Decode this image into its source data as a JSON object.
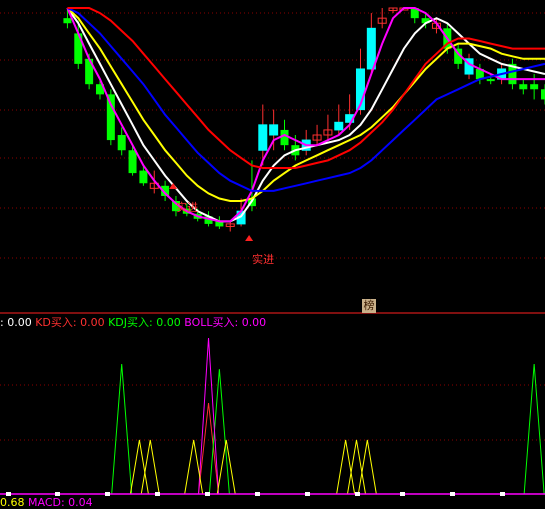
{
  "colors": {
    "bg": "#000000",
    "grid": "#8b0000",
    "up": "#00ffff",
    "down": "#00ff00",
    "ma_white": "#ffffff",
    "ma_yellow": "#ffff00",
    "ma_magenta": "#ff00ff",
    "ma_blue": "#0000ff",
    "ma_red": "#ff0000",
    "signal_text": "#ff3030"
  },
  "price_panel": {
    "signal_labels": [
      "实进",
      "实进",
      "实进"
    ],
    "badge": "榜"
  },
  "indicator_legend": {
    "items": [
      {
        "label": ": 0.00",
        "color": "#ffffff"
      },
      {
        "label": "KD买入: 0.00",
        "color": "#ff3030"
      },
      {
        "label": "KDJ买入: 0.00",
        "color": "#00ff00"
      },
      {
        "label": "BOLL买入: 0.00",
        "color": "#ff00ff"
      }
    ]
  },
  "macd_legend": {
    "items": [
      {
        "label": "0.68",
        "color": "#ffff00"
      },
      {
        "label": "MACD: 0.04",
        "color": "#ff00ff"
      }
    ]
  },
  "chart_data": [
    {
      "type": "candlestick",
      "title": "",
      "ylim": [
        0,
        100
      ],
      "candles": [
        {
          "o": 96,
          "c": 94,
          "h": 100,
          "l": 92,
          "up": false
        },
        {
          "o": 90,
          "c": 78,
          "h": 95,
          "l": 76,
          "up": false
        },
        {
          "o": 80,
          "c": 70,
          "h": 82,
          "l": 68,
          "up": false
        },
        {
          "o": 70,
          "c": 66,
          "h": 72,
          "l": 64,
          "up": false
        },
        {
          "o": 66,
          "c": 48,
          "h": 68,
          "l": 46,
          "up": false
        },
        {
          "o": 50,
          "c": 44,
          "h": 53,
          "l": 42,
          "up": false
        },
        {
          "o": 44,
          "c": 35,
          "h": 46,
          "l": 34,
          "up": false
        },
        {
          "o": 36,
          "c": 31,
          "h": 38,
          "l": 30,
          "up": false
        },
        {
          "o": 31,
          "c": 29,
          "h": 36,
          "l": 27,
          "up": true
        },
        {
          "o": 30,
          "c": 26,
          "h": 32,
          "l": 24,
          "up": false
        },
        {
          "o": 24,
          "c": 20,
          "h": 26,
          "l": 18,
          "up": false
        },
        {
          "o": 21,
          "c": 19,
          "h": 23,
          "l": 18,
          "up": false
        },
        {
          "o": 19,
          "c": 17,
          "h": 21,
          "l": 16,
          "up": false
        },
        {
          "o": 18,
          "c": 15,
          "h": 20,
          "l": 14,
          "up": false
        },
        {
          "o": 16,
          "c": 14,
          "h": 18,
          "l": 13,
          "up": false
        },
        {
          "o": 15,
          "c": 14,
          "h": 16,
          "l": 12,
          "up": true
        },
        {
          "o": 15,
          "c": 20,
          "h": 25,
          "l": 14,
          "up": true
        },
        {
          "o": 25,
          "c": 22,
          "h": 40,
          "l": 20,
          "up": false
        },
        {
          "o": 44,
          "c": 54,
          "h": 62,
          "l": 38,
          "up": true
        },
        {
          "o": 50,
          "c": 54,
          "h": 60,
          "l": 44,
          "up": true
        },
        {
          "o": 52,
          "c": 46,
          "h": 56,
          "l": 44,
          "up": false
        },
        {
          "o": 46,
          "c": 42,
          "h": 50,
          "l": 40,
          "up": false
        },
        {
          "o": 44,
          "c": 48,
          "h": 52,
          "l": 42,
          "up": true
        },
        {
          "o": 48,
          "c": 50,
          "h": 54,
          "l": 46,
          "up": true
        },
        {
          "o": 50,
          "c": 52,
          "h": 58,
          "l": 48,
          "up": true
        },
        {
          "o": 52,
          "c": 55,
          "h": 62,
          "l": 50,
          "up": true
        },
        {
          "o": 55,
          "c": 58,
          "h": 66,
          "l": 52,
          "up": true
        },
        {
          "o": 60,
          "c": 76,
          "h": 84,
          "l": 58,
          "up": true
        },
        {
          "o": 76,
          "c": 92,
          "h": 98,
          "l": 74,
          "up": true
        },
        {
          "o": 94,
          "c": 96,
          "h": 100,
          "l": 92,
          "up": true
        },
        {
          "o": 99,
          "c": 100,
          "h": 100,
          "l": 98,
          "up": true
        },
        {
          "o": 100,
          "c": 100,
          "h": 100,
          "l": 100,
          "up": true
        },
        {
          "o": 100,
          "c": 96,
          "h": 100,
          "l": 94,
          "up": false
        },
        {
          "o": 96,
          "c": 94,
          "h": 98,
          "l": 92,
          "up": false
        },
        {
          "o": 94,
          "c": 92,
          "h": 96,
          "l": 90,
          "up": true
        },
        {
          "o": 92,
          "c": 84,
          "h": 94,
          "l": 82,
          "up": false
        },
        {
          "o": 84,
          "c": 78,
          "h": 86,
          "l": 76,
          "up": false
        },
        {
          "o": 80,
          "c": 74,
          "h": 82,
          "l": 72,
          "up": true
        },
        {
          "o": 76,
          "c": 72,
          "h": 78,
          "l": 70,
          "up": false
        },
        {
          "o": 72,
          "c": 72,
          "h": 74,
          "l": 70,
          "up": false
        },
        {
          "o": 72,
          "c": 76,
          "h": 78,
          "l": 70,
          "up": true
        },
        {
          "o": 78,
          "c": 70,
          "h": 80,
          "l": 68,
          "up": false
        },
        {
          "o": 70,
          "c": 68,
          "h": 72,
          "l": 66,
          "up": false
        },
        {
          "o": 70,
          "c": 68,
          "h": 74,
          "l": 64,
          "up": false
        },
        {
          "o": 68,
          "c": 64,
          "h": 70,
          "l": 62,
          "up": false
        }
      ],
      "series": [
        {
          "color": "#ffffff",
          "values": [
            100,
            94,
            86,
            78,
            70,
            62,
            54,
            46,
            40,
            34,
            29,
            24,
            20,
            18,
            16,
            16,
            18,
            24,
            32,
            38,
            42,
            44,
            45,
            46,
            47,
            48,
            50,
            54,
            60,
            68,
            76,
            84,
            90,
            94,
            96,
            94,
            90,
            86,
            82,
            80,
            78,
            77,
            76,
            75,
            74
          ]
        },
        {
          "color": "#ffff00",
          "values": [
            100,
            96,
            90,
            84,
            77,
            70,
            63,
            56,
            50,
            44,
            39,
            34,
            30,
            27,
            25,
            24,
            24,
            25,
            28,
            32,
            35,
            38,
            40,
            42,
            44,
            46,
            48,
            50,
            53,
            57,
            61,
            66,
            71,
            76,
            80,
            84,
            86,
            86,
            85,
            84,
            82,
            81,
            80,
            80,
            80
          ]
        },
        {
          "color": "#ff00ff",
          "values": [
            100,
            90,
            80,
            72,
            62,
            54,
            46,
            38,
            32,
            27,
            23,
            20,
            18,
            17,
            16,
            16,
            20,
            28,
            40,
            48,
            50,
            48,
            46,
            46,
            48,
            50,
            54,
            62,
            74,
            86,
            96,
            100,
            100,
            98,
            94,
            88,
            82,
            78,
            76,
            74,
            72,
            72,
            72,
            72,
            72
          ]
        },
        {
          "color": "#0000ff",
          "values": [
            100,
            98,
            94,
            90,
            85,
            80,
            75,
            70,
            64,
            58,
            53,
            48,
            43,
            39,
            35,
            32,
            30,
            28,
            28,
            28,
            29,
            30,
            31,
            32,
            33,
            34,
            35,
            37,
            40,
            44,
            48,
            52,
            56,
            60,
            64,
            66,
            68,
            70,
            72,
            73,
            74,
            75,
            76,
            77,
            78
          ]
        },
        {
          "color": "#ff0000",
          "values": [
            100,
            100,
            100,
            98,
            95,
            91,
            87,
            82,
            77,
            72,
            67,
            62,
            57,
            52,
            48,
            44,
            41,
            38,
            37,
            37,
            37,
            37,
            38,
            39,
            40,
            42,
            44,
            47,
            51,
            55,
            60,
            66,
            72,
            78,
            82,
            86,
            88,
            88,
            87,
            86,
            85,
            84,
            84,
            84,
            84
          ]
        }
      ]
    },
    {
      "type": "line",
      "title": "",
      "ylim": [
        0,
        1
      ],
      "series": [
        {
          "name": "KD买入",
          "color": "#ff3030",
          "values": [
            0,
            0,
            0,
            0,
            0,
            0,
            0,
            0,
            0,
            0,
            0,
            0,
            0,
            0.7,
            0,
            0,
            0,
            0,
            0,
            0,
            0,
            0,
            0,
            0,
            0,
            0,
            0,
            0,
            0,
            0,
            0,
            0,
            0,
            0,
            0,
            0,
            0,
            0,
            0,
            0,
            0,
            0,
            0,
            0,
            0
          ]
        },
        {
          "name": "KDJ买入",
          "color": "#00ff00",
          "values": [
            0,
            0,
            0,
            0,
            0,
            1,
            0,
            0,
            0,
            0,
            0,
            0,
            0,
            0,
            0.96,
            0,
            0,
            0,
            0,
            0,
            0,
            0,
            0,
            0,
            0,
            0,
            0,
            0,
            0,
            0,
            0,
            0,
            0,
            0,
            0,
            0,
            0,
            0,
            0,
            0,
            0,
            0,
            0,
            1,
            0
          ]
        },
        {
          "name": "BOLL买入",
          "color": "#ff00ff",
          "values": [
            0,
            0,
            0,
            0,
            0,
            0,
            0,
            0,
            0,
            0,
            0,
            0,
            0,
            1.2,
            0,
            0,
            0,
            0,
            0,
            0,
            0,
            0,
            0,
            0,
            0,
            0,
            0,
            0,
            0,
            0,
            0,
            0,
            0,
            0,
            0,
            0,
            0,
            0,
            0,
            0,
            0,
            0,
            0,
            0,
            0
          ]
        }
      ]
    }
  ]
}
